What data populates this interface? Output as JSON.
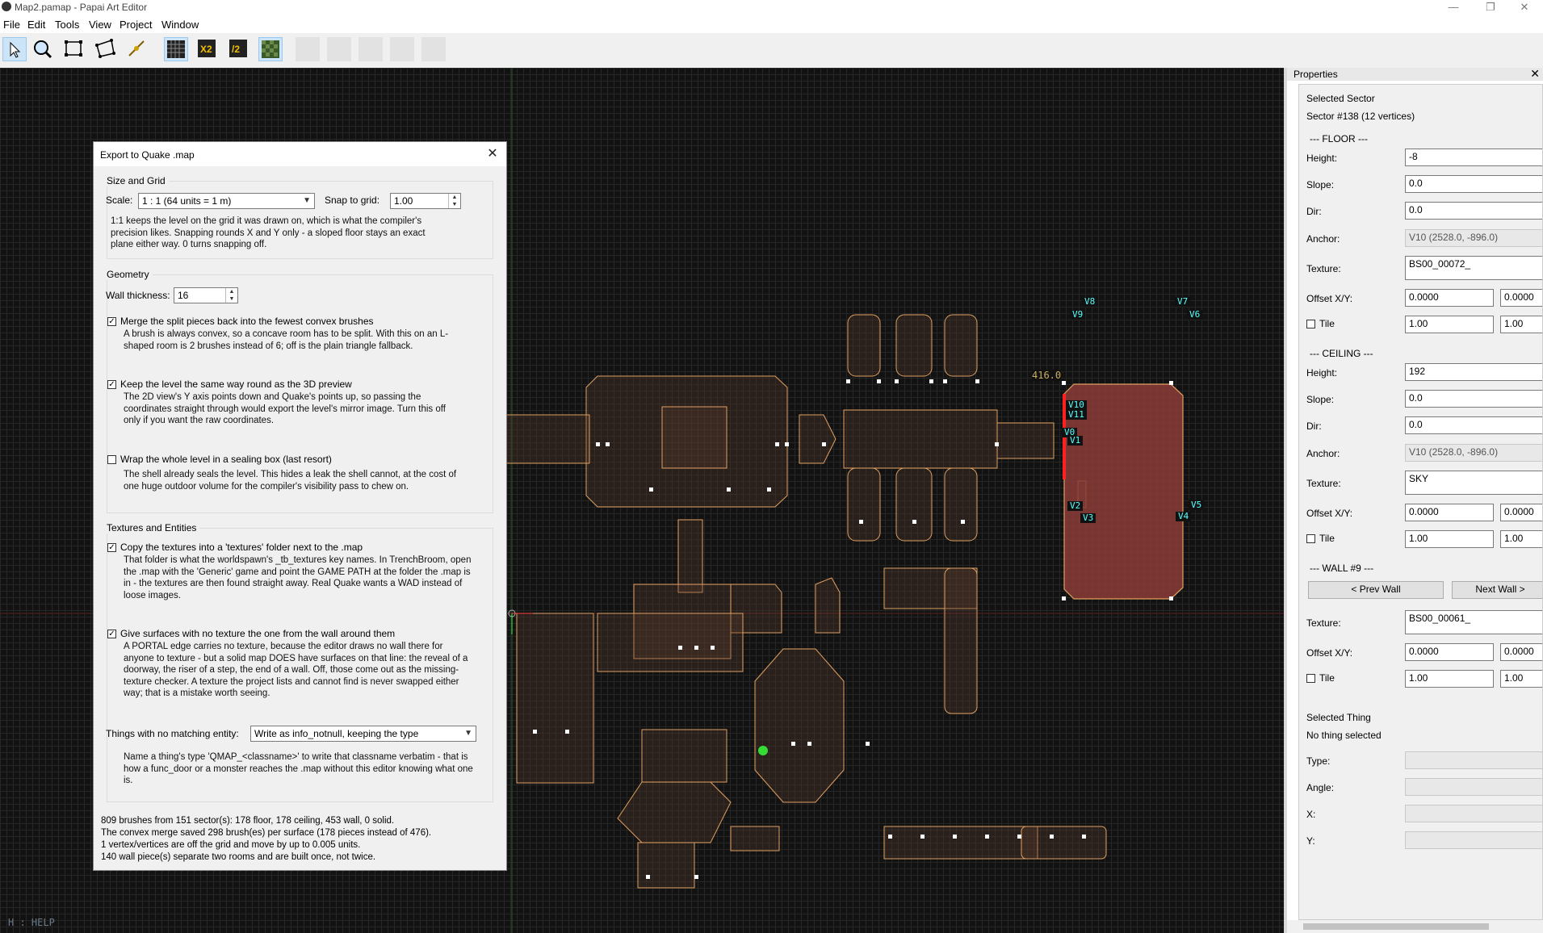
{
  "window": {
    "title": "Map2.pamap - Papai Art Editor",
    "minimize": "—",
    "restore": "❐",
    "close": "✕"
  },
  "menu": [
    "File",
    "Edit",
    "Tools",
    "View",
    "Project",
    "Window"
  ],
  "toolbar": {
    "tools": [
      "select-tool",
      "zoom-tool",
      "rectangle-tool",
      "sector-draw-tool",
      "line-tool",
      "grid-toggle",
      "grid-double",
      "grid-half",
      "texture-preview"
    ],
    "x2_label": "X2",
    "half_label": "/2"
  },
  "canvas": {
    "help_text": "H : HELP",
    "measure_label": "416.0",
    "vertex_labels": [
      "V8",
      "V7",
      "V9",
      "V6",
      "V10",
      "V11",
      "V0",
      "V1",
      "V2",
      "V5",
      "V3",
      "V4"
    ]
  },
  "dialog": {
    "title": "Export to Quake .map",
    "close": "✕",
    "size_grid": {
      "title": "Size and Grid",
      "scale_label": "Scale:",
      "scale_value": "1 : 1 (64 units = 1 m)",
      "snap_label": "Snap to grid:",
      "snap_value": "1.00",
      "desc": "1:1 keeps the level on the grid it was drawn on, which is what the compiler's precision likes. Snapping rounds X and Y only - a sloped floor stays an exact plane either way. 0 turns snapping off."
    },
    "geometry": {
      "title": "Geometry",
      "wall_label": "Wall thickness:",
      "wall_value": "16",
      "merge_label": "Merge the split pieces back into the fewest convex brushes",
      "merge_checked": true,
      "merge_desc": "A brush is always convex, so a concave room has to be split. With this on an L-shaped room is 2 brushes instead of 6; off is the plain triangle fallback.",
      "keep_label": "Keep the level the same way round as the 3D preview",
      "keep_checked": true,
      "keep_desc": "The 2D view's Y axis points down and Quake's points up, so passing the coordinates straight through would export the level's mirror image. Turn this off only if you want the raw coordinates.",
      "wrap_label": "Wrap the whole level in a sealing box (last resort)",
      "wrap_checked": false,
      "wrap_desc": "The shell already seals the level. This hides a leak the shell cannot, at the cost of one huge outdoor volume for the compiler's visibility pass to chew on."
    },
    "textures": {
      "title": "Textures and Entities",
      "copy_label": "Copy the textures into a 'textures' folder next to the .map",
      "copy_checked": true,
      "copy_desc": "That folder is what the worldspawn's _tb_textures key names. In TrenchBroom, open the .map with the 'Generic' game and point the GAME PATH at the folder the .map is in - the textures are then found straight away. Real Quake wants a WAD instead of loose images.",
      "give_label": "Give surfaces with no texture the one from the wall around them",
      "give_checked": true,
      "give_desc": "A PORTAL edge carries no texture, because the editor draws no wall there for anyone to texture - but a solid map DOES have surfaces on that line: the reveal of a doorway, the riser of a step, the end of a wall. Off, those come out as the missing-texture checker. A texture the project lists and cannot find is never swapped either way; that is a mistake worth seeing.",
      "things_label": "Things with no matching entity:",
      "things_value": "Write as info_notnull, keeping the type",
      "things_desc": "Name a thing's type 'QMAP_<classname>' to write that classname verbatim - that is how a func_door or a monster reaches the .map without this editor knowing what one is."
    },
    "summary": [
      "809 brushes from 151 sector(s): 178 floor, 178 ceiling, 453 wall, 0 solid.",
      "The convex merge saved 298 brush(es) per surface (178 pieces instead of 476).",
      "1 vertex/vertices are off the grid and move by up to 0.005 units.",
      "140 wall piece(s) separate two rooms and are built once, not twice."
    ]
  },
  "properties": {
    "header": "Properties",
    "close": "✕",
    "selected_sector": "Selected Sector",
    "sector_info": "Sector #138 (12 vertices)",
    "floor": {
      "header": "--- FLOOR ---",
      "height_label": "Height:",
      "height": "-8",
      "slope_label": "Slope:",
      "slope": "0.0",
      "dir_label": "Dir:",
      "dir": "0.0",
      "anchor_label": "Anchor:",
      "anchor": "V10 (2528.0, -896.0)",
      "texture_label": "Texture:",
      "texture": "BS00_00072_",
      "offset_label": "Offset X/Y:",
      "offset_x": "0.0000",
      "offset_y": "0.0000",
      "tile_label": "Tile",
      "tile_x": "1.00",
      "tile_y": "1.00"
    },
    "ceiling": {
      "header": "--- CEILING ---",
      "height_label": "Height:",
      "height": "192",
      "slope_label": "Slope:",
      "slope": "0.0",
      "dir_label": "Dir:",
      "dir": "0.0",
      "anchor_label": "Anchor:",
      "anchor": "V10 (2528.0, -896.0)",
      "texture_label": "Texture:",
      "texture": "SKY",
      "offset_label": "Offset X/Y:",
      "offset_x": "0.0000",
      "offset_y": "0.0000",
      "tile_label": "Tile",
      "tile_x": "1.00",
      "tile_y": "1.00"
    },
    "wall": {
      "header": "--- WALL #9 ---",
      "prev": "< Prev Wall",
      "next": "Next Wall >",
      "texture_label": "Texture:",
      "texture": "BS00_00061_",
      "offset_label": "Offset X/Y:",
      "offset_x": "0.0000",
      "offset_y": "0.0000",
      "tile_label": "Tile",
      "tile_x": "1.00",
      "tile_y": "1.00"
    },
    "thing": {
      "header": "Selected Thing",
      "info": "No thing selected",
      "type_label": "Type:",
      "angle_label": "Angle:",
      "x_label": "X:",
      "y_label": "Y:"
    }
  },
  "colors": {
    "sector_line": "#e0a060",
    "selected_fill": "#8c3c37",
    "vertex": "#ffffff",
    "vertex_label": "#55ffff",
    "grid": "#262626"
  }
}
